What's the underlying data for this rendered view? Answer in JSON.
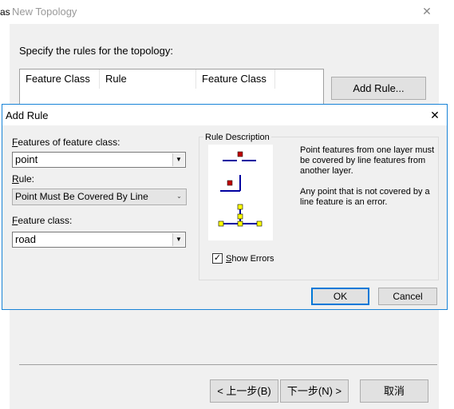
{
  "background_window": {
    "title_prefix": "as",
    "title": "New Topology",
    "instruction": "Specify the rules for the topology:",
    "table_headers": [
      "Feature Class",
      "Rule",
      "Feature Class"
    ],
    "add_rule_label": "Add Rule...",
    "back_label": "< 上一步(B)",
    "next_label": "下一步(N) >",
    "cancel_label": "取消"
  },
  "dialog": {
    "title": "Add Rule",
    "features_label_key": "F",
    "features_label_rest": "eatures of feature class:",
    "features_value": "point",
    "rule_label_key": "R",
    "rule_label_rest": "ule:",
    "rule_value": "Point Must Be Covered By Line",
    "feature_class_label_key": "F",
    "feature_class_label_rest": "eature class:",
    "feature_class_value": "road",
    "rule_description_title": "Rule Description",
    "description_1": "Point features from one layer must be covered by line features from another layer.",
    "description_2": "Any point that is not covered by a line feature is an error.",
    "show_errors_key": "S",
    "show_errors_rest": "how Errors",
    "show_errors_checked": true,
    "ok_label": "OK",
    "cancel_label": "Cancel"
  },
  "colors": {
    "accent": "#0078d7",
    "dialog_border": "#1883d7",
    "error_point": "#c00000",
    "line": "#0000a0",
    "vertex": "#ffff00"
  }
}
